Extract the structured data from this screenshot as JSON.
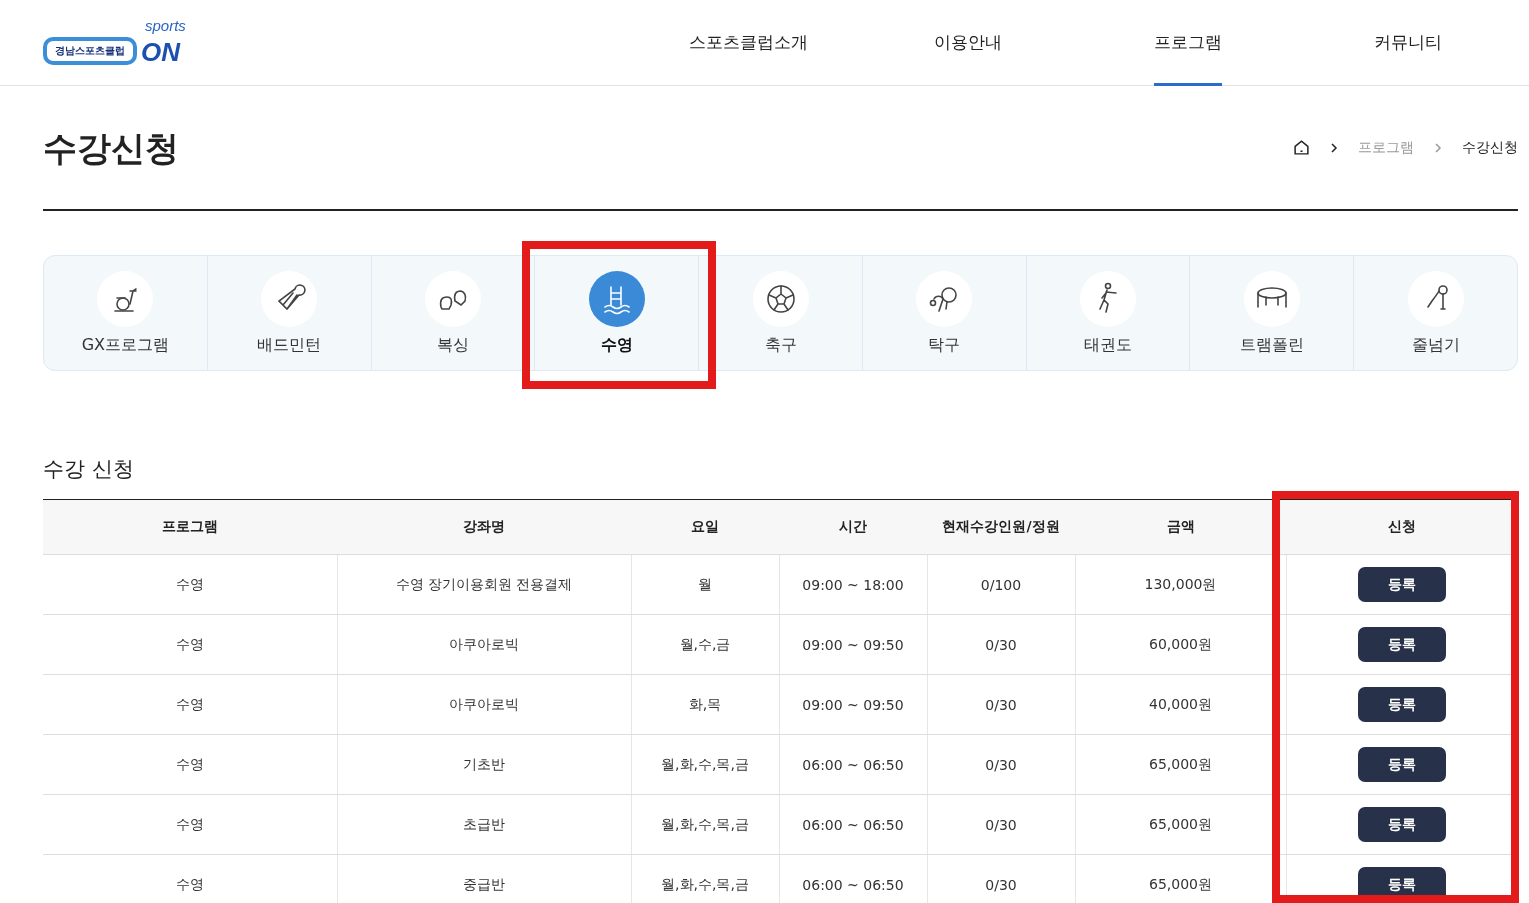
{
  "logo": {
    "name": "경남스포츠클럽",
    "tagline": "sports",
    "mark": "ON"
  },
  "nav": [
    {
      "label": "스포츠클럽소개",
      "selected": false
    },
    {
      "label": "이용안내",
      "selected": false
    },
    {
      "label": "프로그램",
      "selected": true
    },
    {
      "label": "커뮤니티",
      "selected": false
    }
  ],
  "page_title": "수강신청",
  "breadcrumb": [
    {
      "label": "프로그램",
      "current": false
    },
    {
      "label": "수강신청",
      "current": true
    }
  ],
  "categories": [
    {
      "label": "GX프로그램",
      "kind": "bike",
      "selected": false
    },
    {
      "label": "배드민턴",
      "kind": "shuttlecock",
      "selected": false
    },
    {
      "label": "복싱",
      "kind": "gloves",
      "selected": false
    },
    {
      "label": "수영",
      "kind": "pool",
      "selected": true
    },
    {
      "label": "축구",
      "kind": "ball",
      "selected": false
    },
    {
      "label": "탁구",
      "kind": "pingpong",
      "selected": false
    },
    {
      "label": "태권도",
      "kind": "kick",
      "selected": false
    },
    {
      "label": "트램폴린",
      "kind": "trampoline",
      "selected": false
    },
    {
      "label": "줄넘기",
      "kind": "rope",
      "selected": false
    }
  ],
  "section_title": "수강 신청",
  "table": {
    "columns": [
      "프로그램",
      "강좌명",
      "요일",
      "시간",
      "현재수강인원/정원",
      "금액",
      "신청"
    ],
    "rows": [
      [
        "수영",
        "수영 장기이용회원 전용결제",
        "월",
        "09:00 ~ 18:00",
        "0/100",
        "130,000원",
        "등록"
      ],
      [
        "수영",
        "아쿠아로빅",
        "월,수,금",
        "09:00 ~ 09:50",
        "0/30",
        "60,000원",
        "등록"
      ],
      [
        "수영",
        "아쿠아로빅",
        "화,목",
        "09:00 ~ 09:50",
        "0/30",
        "40,000원",
        "등록"
      ],
      [
        "수영",
        "기초반",
        "월,화,수,목,금",
        "06:00 ~ 06:50",
        "0/30",
        "65,000원",
        "등록"
      ],
      [
        "수영",
        "초급반",
        "월,화,수,목,금",
        "06:00 ~ 06:50",
        "0/30",
        "65,000원",
        "등록"
      ],
      [
        "수영",
        "중급반",
        "월,화,수,목,금",
        "06:00 ~ 06:50",
        "0/30",
        "65,000원",
        "등록"
      ]
    ]
  }
}
